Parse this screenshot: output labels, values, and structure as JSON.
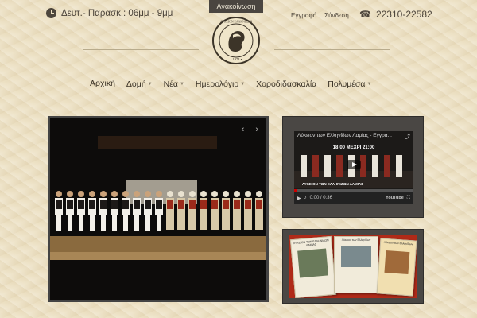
{
  "header": {
    "announcement_tab": "Ανακοίνωση",
    "hours": "Δευτ.- Παρασκ.: 06μμ - 9μμ",
    "register": "Εγγραφή",
    "login": "Σύνδεση",
    "phone": "22310-22582",
    "logo_alt": "Λύκειον των Ελληνίδων Λαμίας 1974"
  },
  "nav": {
    "items": [
      {
        "label": "Αρχική",
        "active": true,
        "dropdown": false
      },
      {
        "label": "Δομή",
        "active": false,
        "dropdown": true
      },
      {
        "label": "Νέα",
        "active": false,
        "dropdown": true
      },
      {
        "label": "Ημερολόγιο",
        "active": false,
        "dropdown": true
      },
      {
        "label": "Χοροδιδασκαλία",
        "active": false,
        "dropdown": false
      },
      {
        "label": "Πολυμέσα",
        "active": false,
        "dropdown": true
      }
    ]
  },
  "slider": {
    "prev": "‹",
    "next": "›"
  },
  "video": {
    "title": "Λύκειον των Ελληνίδων Λαμίας - Εγγρα...",
    "caption": "18:00 ΜΕΧΡΙ 21:00",
    "subcaption": "ΛΥΚΕΙΟΝ ΤΩΝ ΕΛΛΗΝΙΔΩΝ ΛΑΜΙΑΣ",
    "time": "0:00 / 0:36",
    "progress": 0.02,
    "brand": "YouTube"
  },
  "brochure": {
    "flyer1": "ΛΥΚΕΙΟΝ ΤΩΝ ΕΛΛΗΝΙΔΩΝ ΛΑΜΙΑΣ",
    "flyer2": "Λύκειον των Ελληνίδων",
    "flyer3": "Λύκειον των Ελληνίδων"
  },
  "colors": {
    "accent": "#b02a18",
    "dark": "#4a4744"
  }
}
